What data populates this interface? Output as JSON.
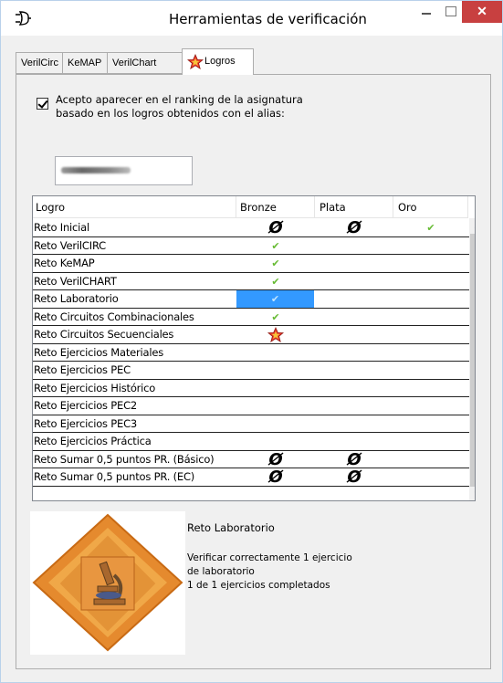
{
  "window": {
    "title": "Herramientas de verificación",
    "close_glyph": "✕"
  },
  "tabs": [
    {
      "label": "VerilCirc"
    },
    {
      "label": "KeMAP"
    },
    {
      "label": "VerilChart"
    },
    {
      "label": "Logros",
      "icon": "star-icon",
      "active": true
    }
  ],
  "ranking": {
    "checked": true,
    "label": "Acepto aparecer en el ranking de la asignatura\nbasado en los logros obtenidos con el alias:"
  },
  "table": {
    "headers": {
      "logro": "Logro",
      "bronze": "Bronze",
      "plata": "Plata",
      "oro": "Oro"
    },
    "rows": [
      {
        "name": "Reto Inicial",
        "bronze": "nosign",
        "plata": "nosign",
        "oro": "tick"
      },
      {
        "name": "Reto VerilCIRC",
        "bronze": "tick",
        "plata": "",
        "oro": ""
      },
      {
        "name": "Reto KeMAP",
        "bronze": "tick",
        "plata": "",
        "oro": ""
      },
      {
        "name": "Reto VerilCHART",
        "bronze": "tick",
        "plata": "",
        "oro": ""
      },
      {
        "name": "Reto Laboratorio",
        "bronze": "tick",
        "plata": "",
        "oro": "",
        "selected": true
      },
      {
        "name": "Reto Circuitos Combinacionales",
        "bronze": "tick",
        "plata": "",
        "oro": ""
      },
      {
        "name": "Reto Circuitos Secuenciales",
        "bronze": "star",
        "plata": "",
        "oro": ""
      },
      {
        "name": "Reto Ejercicios Materiales",
        "bronze": "",
        "plata": "",
        "oro": ""
      },
      {
        "name": "Reto Ejercicios PEC",
        "bronze": "",
        "plata": "",
        "oro": ""
      },
      {
        "name": "Reto Ejercicios Histórico",
        "bronze": "",
        "plata": "",
        "oro": ""
      },
      {
        "name": "Reto Ejercicios PEC2",
        "bronze": "",
        "plata": "",
        "oro": ""
      },
      {
        "name": "Reto Ejercicios PEC3",
        "bronze": "",
        "plata": "",
        "oro": ""
      },
      {
        "name": "Reto Ejercicios Práctica",
        "bronze": "",
        "plata": "",
        "oro": ""
      },
      {
        "name": "Reto Sumar 0,5 puntos PR. (Básico)",
        "bronze": "nosign",
        "plata": "nosign",
        "oro": ""
      },
      {
        "name": "Reto Sumar 0,5 puntos PR. (EC)",
        "bronze": "nosign",
        "plata": "nosign",
        "oro": ""
      }
    ],
    "glyphs": {
      "tick": "✔",
      "nosign": "Ø"
    }
  },
  "scrollbar": {
    "up": "▲",
    "down": "▼"
  },
  "detail": {
    "title": "Reto Laboratorio",
    "description": "Verificar correctamente 1 ejercicio\nde laboratorio\n1 de 1 ejercicios completados",
    "image_icon": "microscope-badge-icon"
  },
  "colors": {
    "selection": "#3399ff",
    "tick": "#66bb33",
    "close": "#c84040",
    "badge": "#e58a2e"
  }
}
